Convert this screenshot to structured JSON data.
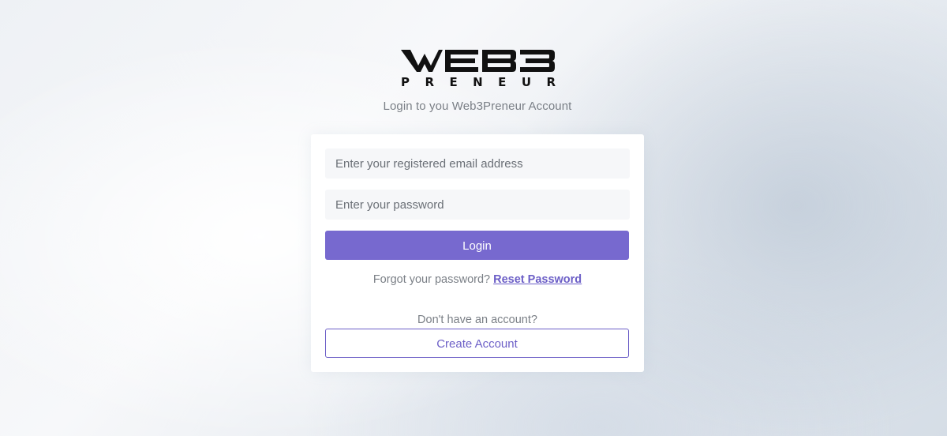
{
  "brand": {
    "logo_name": "web3preneur-logo",
    "logo_text_top": "WEB3",
    "logo_text_bottom": "PRENEUR",
    "logo_color": "#111111"
  },
  "header": {
    "subtitle": "Login to you Web3Preneur Account"
  },
  "login_form": {
    "email_placeholder": "Enter your registered email address",
    "email_value": "",
    "password_placeholder": "Enter your password",
    "password_value": "",
    "login_label": "Login",
    "forgot_text": "Forgot your password?",
    "reset_link_label": "Reset Password",
    "no_account_text": "Don't have an account?",
    "create_account_label": "Create Account"
  },
  "colors": {
    "accent": "#7769cf",
    "accent_text": "#6c5fc7",
    "muted_text": "#7a7f86",
    "input_bg": "#f6f7f9",
    "card_bg": "#ffffff"
  }
}
